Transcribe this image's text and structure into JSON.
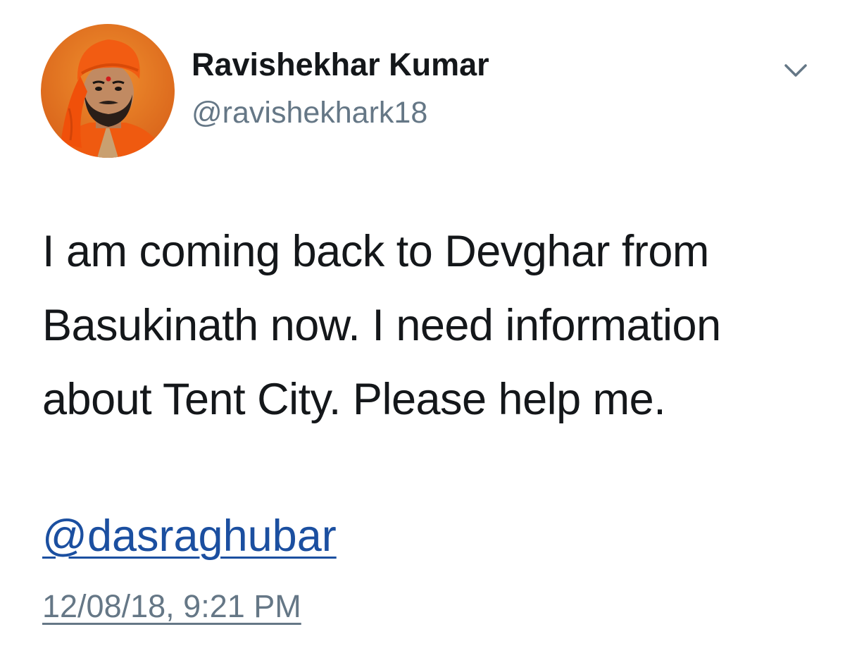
{
  "tweet": {
    "author": {
      "display_name": "Ravishekhar Kumar",
      "handle": "@ravishekhark18"
    },
    "text": "I am coming back to Devghar from Basukinath now. I need information about Tent City. Please help me.",
    "mention": "@dasraghubar",
    "timestamp": "12/08/18, 9:21 PM",
    "menu_icon": "chevron-down-icon"
  },
  "colors": {
    "name": "#14171a",
    "secondary": "#657786",
    "link": "#1b4fa0",
    "avatar_background": "#e2731f",
    "turban": "#f25c12"
  }
}
